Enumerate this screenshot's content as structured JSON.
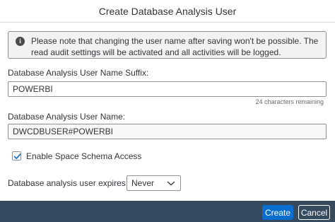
{
  "dialog": {
    "title": "Create Database Analysis User",
    "info_message": "Please note that changing the user name after saving won't be possible. The read audit settings will be activated and all activities will be logged.",
    "suffix_label": "Database Analysis User Name Suffix:",
    "suffix_value": "POWERBI",
    "characters_remaining": "24 characters remaining",
    "username_label": "Database Analysis User Name:",
    "username_value": "DWCDBUSER#POWERBI",
    "schema_access_label": "Enable Space Schema Access",
    "schema_access_checked": true,
    "expires_label": "Database analysis user expires in",
    "expires_value": "Never",
    "create_button": "Create",
    "cancel_button": "Cancel"
  },
  "colors": {
    "footer": "#354a5f",
    "primary_button": "#0a6ed1",
    "info_background": "#f2f2f2",
    "checkmark": "#0a6ed1"
  },
  "icons": {
    "info": "info-icon",
    "checkbox": "checkmark-icon",
    "dropdown": "chevron-down-icon"
  }
}
